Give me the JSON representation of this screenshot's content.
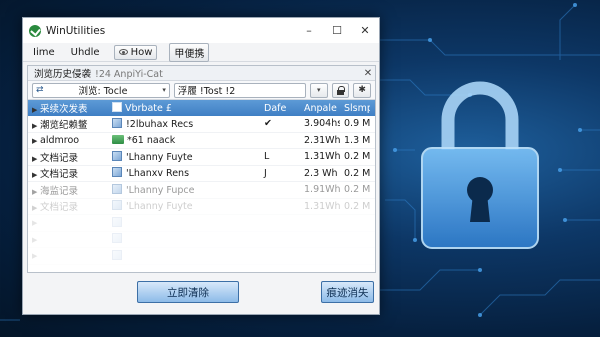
{
  "window": {
    "title": "WinUtilities",
    "minimize": "–",
    "maximize": "☐",
    "close": "✕"
  },
  "menu": {
    "items": [
      "Iime",
      "Uhdle"
    ],
    "view_label": "How",
    "grid_label": "甲便携"
  },
  "panel": {
    "title": "浏览历史侵袭",
    "subtitle": "!24 AnpiYi-Cat",
    "close": "✕"
  },
  "toolbar": {
    "select_label": "浏览: Tocle",
    "field_value": "浮履 !Tost !2",
    "swap_glyph": "⇄",
    "caret": "▾"
  },
  "list": {
    "headers": [
      "采续次发表",
      "Vbrbate £",
      "Dafe",
      "Anpale",
      "Slsmp"
    ],
    "rows": [
      {
        "name": "潮览纪赖鳖",
        "icon": "file",
        "detail": "!2lbuhax Recs",
        "date": "",
        "check": "✔",
        "size": "3.904hs",
        "slots": "0.9 M",
        "state": "normal"
      },
      {
        "name": "aldmroo",
        "icon": "folder",
        "detail": "*61 naack",
        "date": "",
        "check": "",
        "size": "2.31Wh",
        "slots": "1.3 M",
        "state": "normal"
      },
      {
        "name": "文档记录",
        "icon": "file",
        "detail": "'Lhanny Fuyte",
        "date": "L",
        "check": "",
        "size": "1.31Whs",
        "slots": "0.2 M",
        "state": "normal"
      },
      {
        "name": "文档记录",
        "icon": "file",
        "detail": "'Lhanxv Rens",
        "date": "J",
        "check": "",
        "size": "2.3 Wh",
        "slots": "0.2 M",
        "state": "normal"
      },
      {
        "name": "海监记录",
        "icon": "file",
        "detail": "'Lhanny Fupce",
        "date": "",
        "check": "",
        "size": "1.91Wh",
        "slots": "0.2 M",
        "state": "fade1"
      },
      {
        "name": "文档记录",
        "icon": "file",
        "detail": "'Lhanny Fuyte",
        "date": "",
        "check": "",
        "size": "1.31Wh",
        "slots": "0.2 M",
        "state": "fade2"
      },
      {
        "name": "",
        "icon": "file",
        "detail": "",
        "date": "",
        "check": "",
        "size": "",
        "slots": "",
        "state": "fade3"
      },
      {
        "name": "",
        "icon": "file",
        "detail": "",
        "date": "",
        "check": "",
        "size": "",
        "slots": "",
        "state": "fade3"
      },
      {
        "name": "",
        "icon": "file",
        "detail": "",
        "date": "",
        "check": "",
        "size": "",
        "slots": "",
        "state": "fade3"
      }
    ]
  },
  "buttons": {
    "clear": "立即清除",
    "trace": "痕迹消失"
  },
  "icons": [
    "check-app-icon",
    "eye-icon",
    "grid-icon",
    "swap-icon",
    "lock-icon",
    "gear-icon",
    "padlock-graphic"
  ],
  "colors": {
    "accent": "#3f7fc4",
    "background": "#06203f",
    "lock": "#4a9be0"
  }
}
